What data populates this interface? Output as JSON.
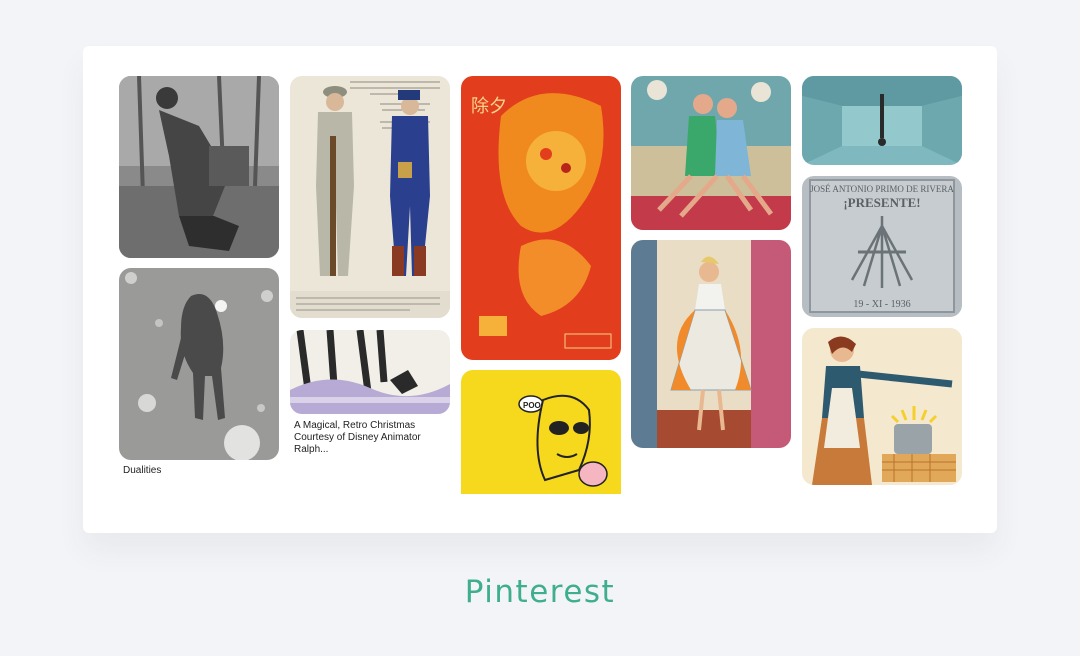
{
  "board": {
    "pins": [
      {
        "caption": ""
      },
      {
        "caption": "Dualities"
      },
      {
        "caption": ""
      },
      {
        "caption": "A Magical, Retro Christmas Courtesy of Disney Animator Ralph..."
      },
      {
        "caption": "",
        "text": {
          "title": "除夕",
          "speech": "POO"
        }
      },
      {
        "caption": ""
      },
      {
        "caption": ""
      },
      {
        "caption": ""
      },
      {
        "caption": ""
      },
      {
        "caption": "",
        "text": {
          "line1": "JOSÉ ANTONIO PRIMO DE RIVERA",
          "line2": "¡PRESENTE!",
          "date": "19 - XI - 1936"
        }
      },
      {
        "caption": ""
      }
    ]
  },
  "footer": {
    "title": "Pinterest"
  },
  "colors": {
    "accent": "#3fae8f",
    "background": "#f3f4f7",
    "card": "#ffffff"
  }
}
